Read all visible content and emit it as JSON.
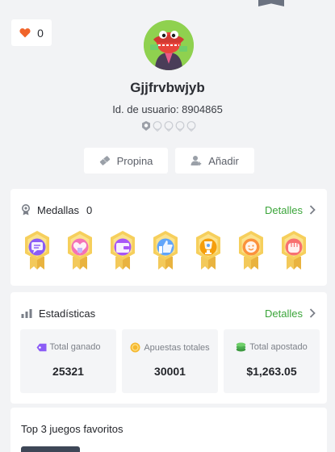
{
  "profile": {
    "likes": "0",
    "username": "Gjjfrvbwjyb",
    "user_id": "Id. de usuario: 8904865",
    "level_total": 5
  },
  "actions": {
    "tip_label": "Propina",
    "add_label": "Añadir"
  },
  "medals": {
    "title": "Medallas",
    "count": "0",
    "details_label": "Detalles",
    "items": [
      {
        "icon": "chat-bubble-icon",
        "color": "#8b5cf6"
      },
      {
        "icon": "heart-gift-icon",
        "color": "#f472b6"
      },
      {
        "icon": "wallet-icon",
        "color": "#a855f7"
      },
      {
        "icon": "thumbs-up-icon",
        "color": "#60a5fa"
      },
      {
        "icon": "trophy-icon",
        "color": "#f59e0b"
      },
      {
        "icon": "wink-face-icon",
        "color": "#fb923c"
      },
      {
        "icon": "fist-icon",
        "color": "#f87171"
      }
    ]
  },
  "stats": {
    "title": "Estadísticas",
    "details_label": "Detalles",
    "tiles": [
      {
        "label": "Total ganado",
        "value": "25321",
        "icon": "tag-icon",
        "color": "#8b5cf6"
      },
      {
        "label": "Apuestas totales",
        "value": "30001",
        "icon": "coin-icon",
        "color": "#f5b82e"
      },
      {
        "label": "Total apostado",
        "value": "$1,263.05",
        "icon": "coin-stack-icon",
        "color": "#4caf50"
      }
    ]
  },
  "favorites": {
    "title": "Top 3 juegos favoritos"
  },
  "colors": {
    "accent": "#3ba53a",
    "like": "#f0642a",
    "background": "#f2f3f5"
  }
}
